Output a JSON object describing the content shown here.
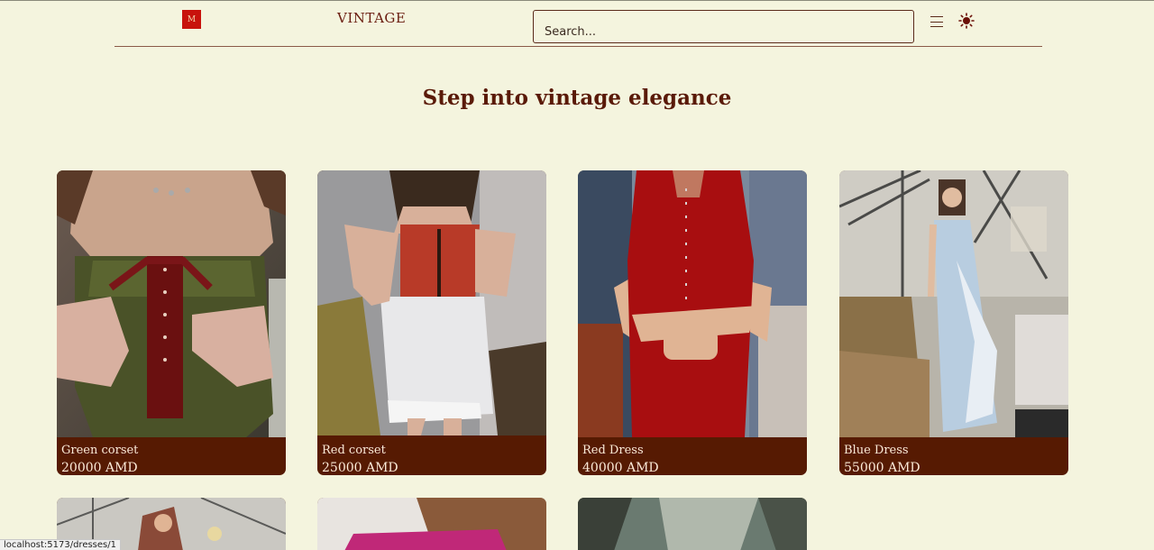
{
  "header": {
    "logo_text": "M",
    "brand": "VINTAGE",
    "search_placeholder": "Search...",
    "menu_icon": "hamburger-menu-icon",
    "theme_icon": "sun-icon"
  },
  "hero": {
    "title": "Step into vintage elegance"
  },
  "products": [
    {
      "name": "Green corset",
      "price": "20000 AMD"
    },
    {
      "name": "Red corset",
      "price": "25000 AMD"
    },
    {
      "name": "Red Dress",
      "price": "40000 AMD"
    },
    {
      "name": "Blue Dress",
      "price": "55000 AMD"
    }
  ],
  "status_bar": {
    "url": "localhost:5173/dresses/1"
  },
  "colors": {
    "background": "#f4f4de",
    "accent": "#561a02",
    "heading": "#5a1a08",
    "logo": "#c8120c"
  }
}
